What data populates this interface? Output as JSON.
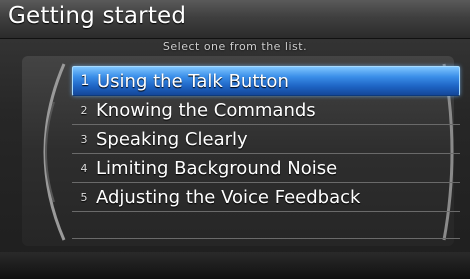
{
  "header": {
    "title": "Getting started",
    "subtitle": "Select one from the list."
  },
  "menu": {
    "selected_index": 0,
    "items": [
      {
        "number": "1",
        "label": "Using the Talk Button"
      },
      {
        "number": "2",
        "label": "Knowing the Commands"
      },
      {
        "number": "3",
        "label": "Speaking Clearly"
      },
      {
        "number": "4",
        "label": "Limiting Background Noise"
      },
      {
        "number": "5",
        "label": "Adjusting the Voice Feedback"
      }
    ]
  },
  "colors": {
    "highlight": "#2a78d8",
    "text": "#ffffff",
    "background": "#272727"
  }
}
